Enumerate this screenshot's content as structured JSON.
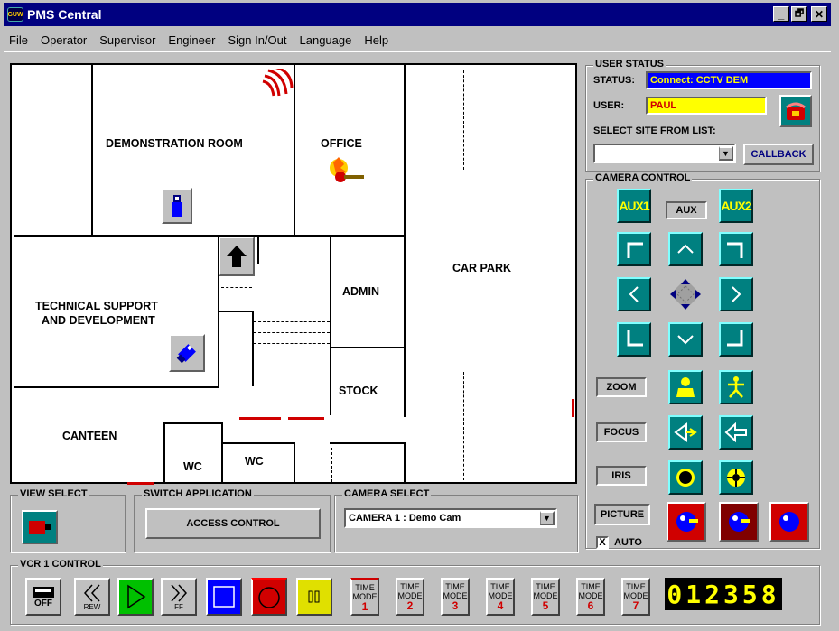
{
  "window": {
    "title": "PMS Central",
    "logo": "GUW",
    "minimize": "_",
    "restore": "🗗",
    "close": "✕"
  },
  "menu": [
    "File",
    "Operator",
    "Supervisor",
    "Engineer",
    "Sign In/Out",
    "Language",
    "Help"
  ],
  "floorplan": {
    "rooms": {
      "demo": "DEMONSTRATION ROOM",
      "office": "OFFICE",
      "carpark": "CAR PARK",
      "admin": "ADMIN",
      "tech1": "TECHNICAL SUPPORT",
      "tech2": "AND DEVELOPMENT",
      "stock": "STOCK",
      "canteen": "CANTEEN",
      "wc1": "WC",
      "wc2": "WC"
    },
    "alarm_color": "#d00000"
  },
  "user_status": {
    "group_label": "USER STATUS",
    "status_label": "STATUS:",
    "status_value": "Connect: CCTV DEM",
    "user_label": "USER:",
    "user_value": "PAUL",
    "site_label": "SELECT SITE FROM LIST:",
    "site_value": "",
    "callback": "CALLBACK"
  },
  "camera_control": {
    "group_label": "CAMERA CONTROL",
    "aux1": "AUX1",
    "aux": "AUX",
    "aux2": "AUX2",
    "zoom": "ZOOM",
    "focus": "FOCUS",
    "iris": "IRIS",
    "picture": "PICTURE",
    "auto_check": "X",
    "auto": "AUTO"
  },
  "view_select": {
    "group_label": "VIEW SELECT"
  },
  "switch_app": {
    "group_label": "SWITCH APPLICATION",
    "button": "ACCESS CONTROL"
  },
  "camera_select": {
    "group_label": "CAMERA SELECT",
    "value": "CAMERA  1 : Demo Cam"
  },
  "vcr": {
    "group_label": "VCR 1 CONTROL",
    "off": "OFF",
    "rew": "REW",
    "ff": "FF",
    "time_label": "TIME\nMODE",
    "time_modes": [
      "1",
      "2",
      "3",
      "4",
      "5",
      "6",
      "7"
    ],
    "counter": "012358"
  }
}
